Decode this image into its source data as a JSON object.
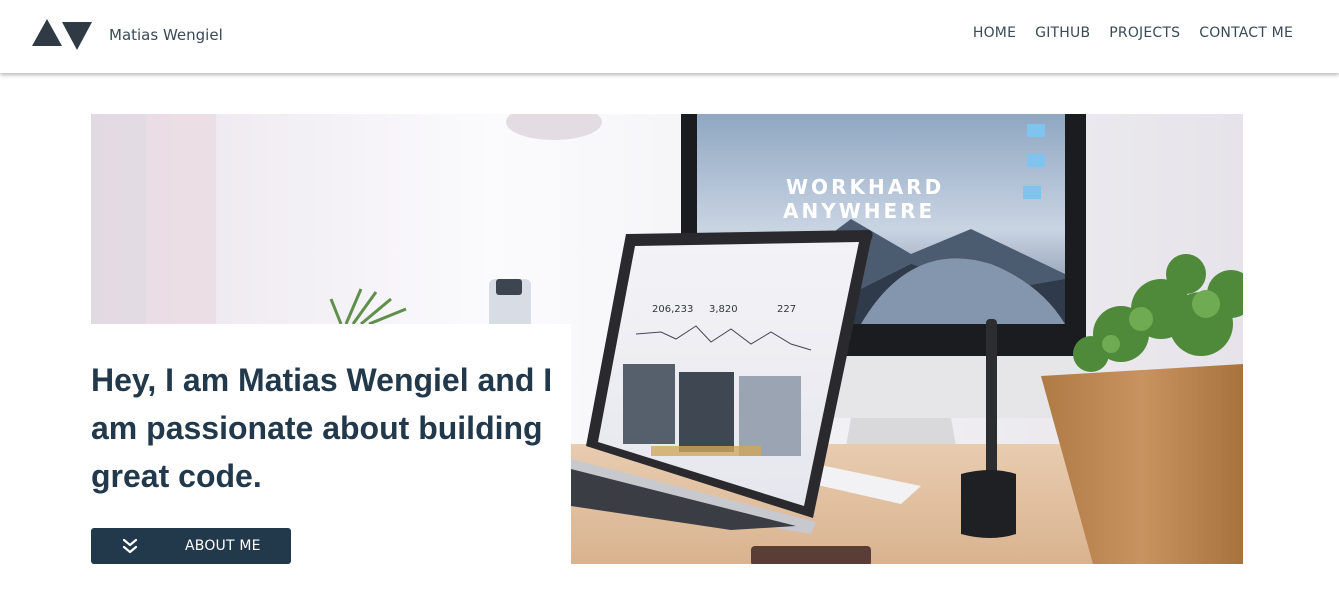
{
  "header": {
    "brand_name": "Matias Wengiel",
    "nav": [
      "HOME",
      "GITHUB",
      "PROJECTS",
      "CONTACT ME"
    ]
  },
  "hero": {
    "headline": "Hey, I am Matias Wengiel and I am passionate about building great code.",
    "about_button": "ABOUT ME",
    "monitor_line1": "WORKHARD",
    "monitor_line2": "ANYWHERE",
    "stats": [
      "206,233",
      "3,820",
      "227"
    ]
  },
  "colors": {
    "primary": "#22384b",
    "nav_text": "#3a4a57",
    "background": "#ffffff"
  }
}
